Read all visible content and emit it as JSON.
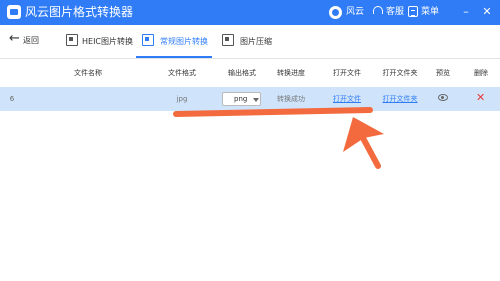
{
  "app": {
    "title": "风云图片格式转换器"
  },
  "topbar": {
    "brand": "风云",
    "support": "客服",
    "menu": "菜单",
    "minimize": "–",
    "close": "✕"
  },
  "nav": {
    "back": "返回",
    "tabs": [
      {
        "label": "HEIC图片转换",
        "icon": "heic-image-icon",
        "active": false
      },
      {
        "label": "常规图片转换",
        "icon": "image-convert-icon",
        "active": true
      },
      {
        "label": "图片压缩",
        "icon": "image-compress-icon",
        "active": false
      }
    ]
  },
  "table": {
    "headers": {
      "filename": "文件名称",
      "format": "文件格式",
      "output": "输出格式",
      "progress": "转换进度",
      "open_file": "打开文件",
      "open_folder": "打开文件夹",
      "preview": "预览",
      "delete": "删除"
    },
    "rows": [
      {
        "index": "6",
        "filename": "",
        "format": "jpg",
        "output": "png",
        "progress": "转换成功",
        "open_file": "打开文件",
        "open_folder": "打开文件夹"
      }
    ]
  },
  "colors": {
    "accent": "#2f7cf6",
    "row_highlight": "#cfe4fb",
    "annotation": "#f26a3d",
    "delete": "#e83b3b"
  }
}
